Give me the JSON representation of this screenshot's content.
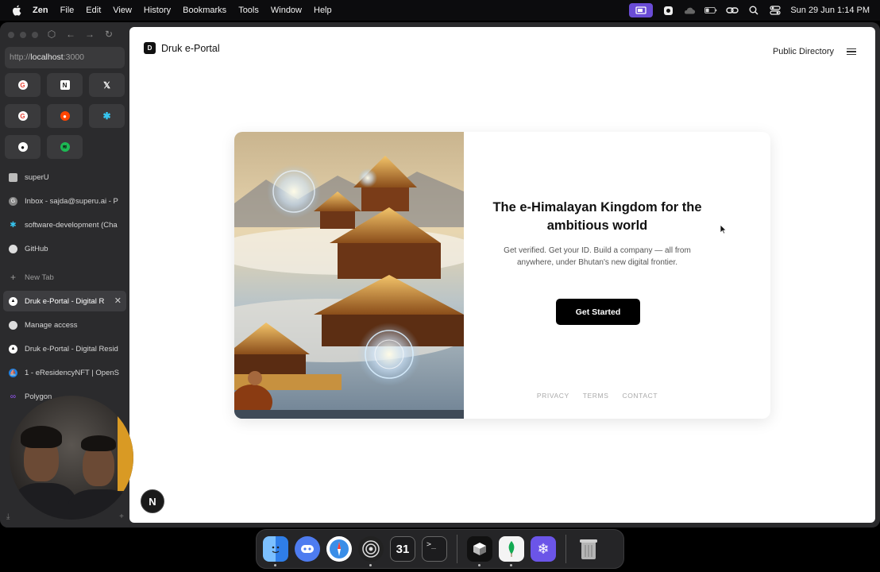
{
  "menubar": {
    "app_name": "Zen",
    "menus": [
      "File",
      "Edit",
      "View",
      "History",
      "Bookmarks",
      "Tools",
      "Window",
      "Help"
    ],
    "clock": "Sun 29 Jun  1:14 PM"
  },
  "browser": {
    "url_prefix": "http://",
    "url_host": "localhost",
    "url_port": ":3000",
    "pinned": [
      {
        "name": "google-icon",
        "color": "#ea4335"
      },
      {
        "name": "notion-icon",
        "color": "#ffffff"
      },
      {
        "name": "x-icon",
        "color": "#ffffff"
      },
      {
        "name": "google-icon",
        "color": "#ea4335"
      },
      {
        "name": "reddit-icon",
        "color": "#ff4500"
      },
      {
        "name": "slack-icon",
        "color": "#36c5f0"
      },
      {
        "name": "github-icon",
        "color": "#ffffff"
      },
      {
        "name": "spotify-icon",
        "color": "#1db954"
      }
    ],
    "tabs": [
      {
        "label": "superU",
        "icon": "bookmark-icon"
      },
      {
        "label": "Inbox - sajda@superu.ai - P",
        "icon": "google-icon"
      },
      {
        "label": "software-development (Cha",
        "icon": "slack-icon"
      },
      {
        "label": "GitHub",
        "icon": "github-icon"
      }
    ],
    "new_tab_label": "New Tab",
    "open_tabs": [
      {
        "label": "Druk e-Portal - Digital R",
        "icon": "vercel-icon",
        "active": true
      },
      {
        "label": "Manage access",
        "icon": "github-icon"
      },
      {
        "label": "Druk e-Portal - Digital Resid",
        "icon": "vercel-icon"
      },
      {
        "label": "1 - eResidencyNFT | OpenS",
        "icon": "opensea-icon"
      },
      {
        "label": "Polygon",
        "icon": "link-icon"
      }
    ]
  },
  "page": {
    "brand_mark": "D",
    "brand_name": "Druk e-Portal",
    "nav_link": "Public Directory",
    "headline": "The e-Himalayan Kingdom for the ambitious world",
    "subtext": "Get verified. Get your ID. Build a company — all from anywhere, under Bhutan's new digital frontier.",
    "cta_label": "Get Started",
    "footer_links": [
      "PRIVACY",
      "TERMS",
      "CONTACT"
    ]
  },
  "next_badge": "N",
  "dock": [
    {
      "name": "finder-icon",
      "color": "#3c8ff0"
    },
    {
      "name": "discord-icon",
      "color": "#4e7cf0"
    },
    {
      "name": "safari-icon",
      "color": "#3a7fe0"
    },
    {
      "name": "radar-icon",
      "color": "#222222"
    },
    {
      "name": "calendar-icon",
      "color": "#1c1c1e",
      "text": "31"
    },
    {
      "name": "terminal-icon",
      "color": "#1c1c1e"
    },
    {
      "name": "cube-app-icon",
      "color": "#111111"
    },
    {
      "name": "mongodb-icon",
      "color": "#f4f4f4"
    },
    {
      "name": "snowflake-app-icon",
      "color": "#6b55e8"
    },
    {
      "name": "trash-icon",
      "color": "#8a8a8a"
    }
  ]
}
